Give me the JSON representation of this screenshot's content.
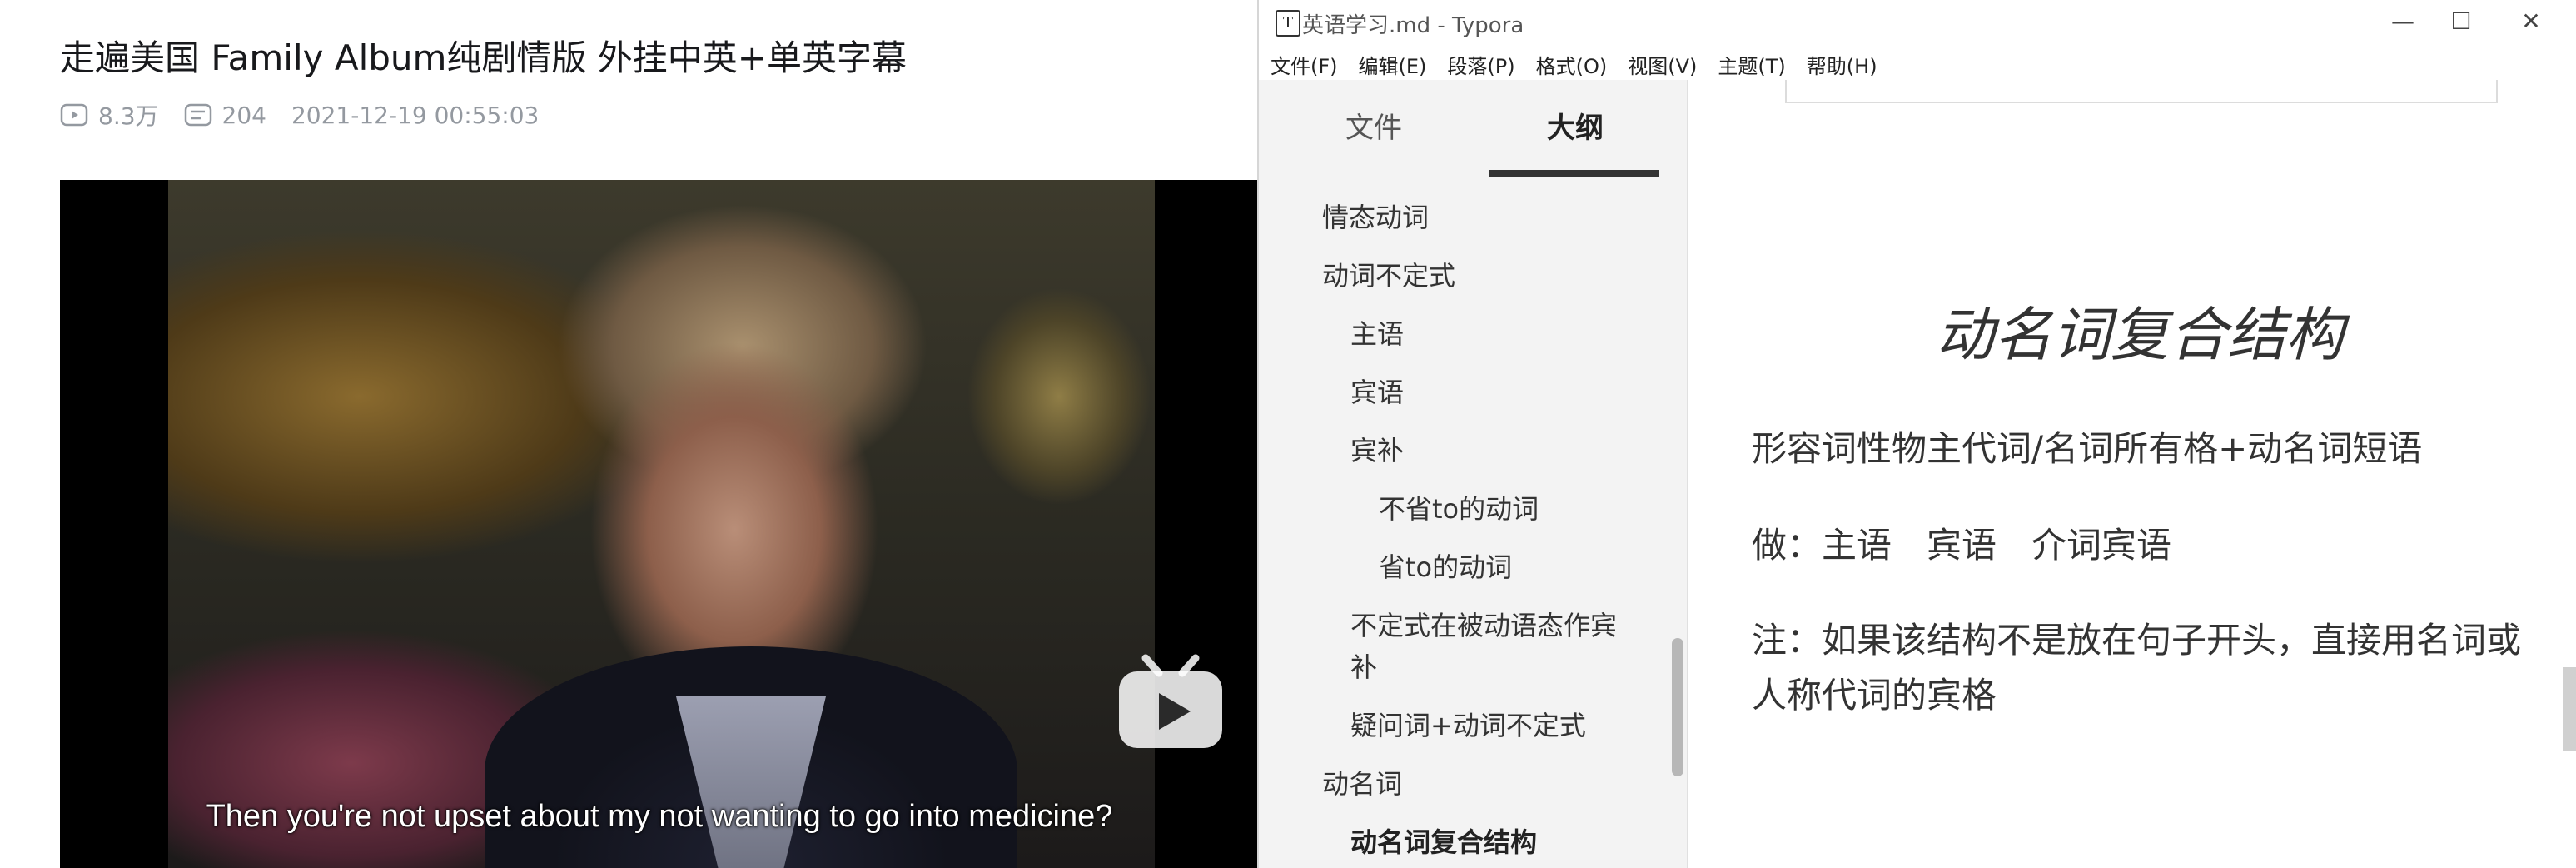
{
  "video": {
    "title": "走遍美国 Family Album纯剧情版 外挂中英+单英字幕",
    "views": "8.3万",
    "danmaku": "204",
    "date": "2021-12-19 00:55:03",
    "subtitle": "Then you're not upset about my not wanting to go into medicine?",
    "play_icon": "play-circle-icon",
    "danmaku_icon": "danmaku-icon"
  },
  "typora": {
    "window_title": "英语学习.md - Typora",
    "app_icon_letter": "T",
    "minimize": "—",
    "maximize": "☐",
    "close": "✕",
    "menu": [
      "文件(F)",
      "编辑(E)",
      "段落(P)",
      "格式(O)",
      "视图(V)",
      "主题(T)",
      "帮助(H)"
    ],
    "tabs": {
      "files": "文件",
      "outline": "大纲"
    },
    "outline": [
      "情态动词",
      "动词不定式",
      "主语",
      "宾语",
      "宾补",
      "不省to的动词",
      "省to的动词",
      "不定式在被动语态作宾",
      "补",
      "疑问词+动词不定式",
      "动名词",
      "动名词复合结构"
    ],
    "doc": {
      "heading": "动名词复合结构",
      "p1": "形容词性物主代词/名词所有格+动名词短语",
      "p2": "做：主语　宾语　介词宾语",
      "p3": "注：如果该结构不是放在句子开头，直接用名词或人称代词的宾格"
    }
  }
}
